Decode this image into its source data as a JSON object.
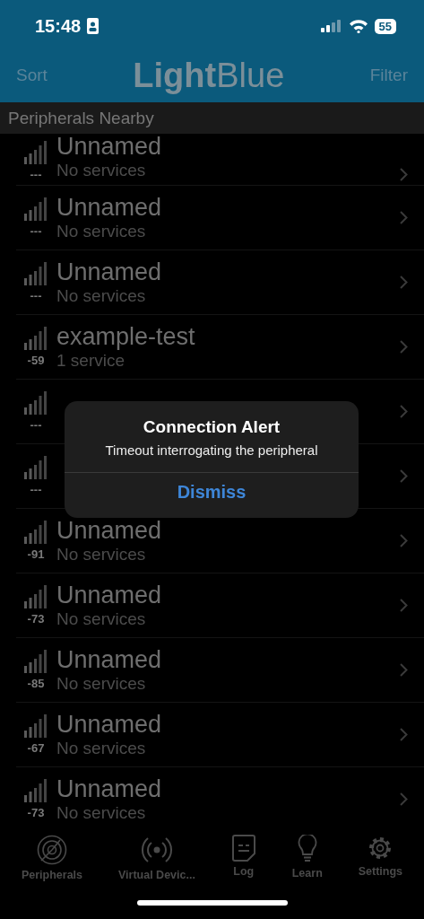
{
  "status_bar": {
    "time": "15:48",
    "battery": "55"
  },
  "nav": {
    "left": "Sort",
    "title": "**Light**Blue",
    "right": "Filter"
  },
  "section": "Peripherals Nearby",
  "peripherals": [
    {
      "rssi": "---",
      "name": "Unnamed",
      "services": "No services"
    },
    {
      "rssi": "---",
      "name": "Unnamed",
      "services": "No services"
    },
    {
      "rssi": "---",
      "name": "Unnamed",
      "services": "No services"
    },
    {
      "rssi": "-59",
      "name": "example-test",
      "services": "1 service"
    },
    {
      "rssi": "---"
    },
    {
      "rssi": "---"
    },
    {
      "rssi": "-91",
      "name": "Unnamed",
      "services": "No services"
    },
    {
      "rssi": "-73",
      "name": "Unnamed",
      "services": "No services"
    },
    {
      "rssi": "-85",
      "name": "Unnamed",
      "services": "No services"
    },
    {
      "rssi": "-67",
      "name": "Unnamed",
      "services": "No services"
    },
    {
      "rssi": "-73",
      "name": "Unnamed",
      "services": "No services"
    }
  ],
  "alert": {
    "title": "Connection Alert",
    "message": "Timeout interrogating the peripheral",
    "button": "Dismiss"
  },
  "tabs": [
    {
      "kind": "radar",
      "label": "Peripherals"
    },
    {
      "kind": "broadcast",
      "label": "Virtual Devic..."
    },
    {
      "kind": "note",
      "label": "Log"
    },
    {
      "kind": "bulb",
      "label": "Learn"
    },
    {
      "kind": "gear",
      "label": "Settings"
    }
  ]
}
